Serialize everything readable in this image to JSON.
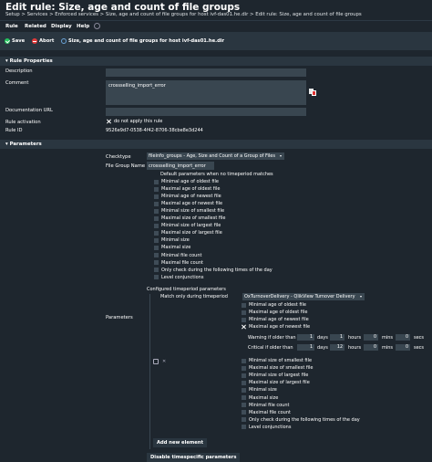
{
  "header": {
    "title": "Edit rule: Size, age and count of file groups",
    "breadcrumb": "Setup > Services > Enforced services > Size, age and count of file groups for host ivf-das01.he.dir > Edit rule: Size, age and count of file groups"
  },
  "menubar": {
    "rule": "Rule",
    "related": "Related",
    "display": "Display",
    "help": "Help"
  },
  "toolbar": {
    "save": "Save",
    "abort": "Abort",
    "service_link": "Size, age and count of file groups for host ivf-das01.he.dir"
  },
  "rule_properties": {
    "heading": "Rule Properties",
    "description_label": "Description",
    "comment_label": "Comment",
    "comment_value": "crossselling_import_error",
    "doc_url_label": "Documentation URL",
    "activation_label": "Rule activation",
    "activation_text": "do not apply this rule",
    "rule_id_label": "Rule ID",
    "rule_id_value": "9526e9d7-0538-4f42-8706-38cbe8e3d244"
  },
  "parameters": {
    "heading": "Parameters",
    "checktype_label": "Checktype",
    "checktype_value": "fileinfo_groups - Age, Size and Count of a Group of Files",
    "file_group_label": "File Group Name",
    "file_group_value": "crossselling_import_error",
    "params_label": "Parameters",
    "default_heading": "Default parameters when no timeperiod matches",
    "default_items": [
      "Minimal age of oldest file",
      "Maximal age of oldest file",
      "Minimal age of newest file",
      "Maximal age of newest file",
      "Minimal size of smallest file",
      "Maximal size of smallest file",
      "Minimal size of largest file",
      "Maximal size of largest file",
      "Minimal size",
      "Maximal size",
      "Minimal file count",
      "Maximal file count",
      "Only check during the following times of the day",
      "Level conjunctions"
    ],
    "configured_heading": "Configured timeperiod parameters",
    "match_label": "Match only during timeperiod",
    "match_value": "OxTurnoverDelivery - QlikView Turnover Delivery",
    "tp_items_top": [
      "Minimal age of oldest file",
      "Maximal age of oldest file",
      "Minimal age of newest file",
      "Maximal age of newest file"
    ],
    "warning_label": "Warning if older than",
    "critical_label": "Critical if older than",
    "warning": {
      "days": "1",
      "hours": "1",
      "mins": "0",
      "secs": "0"
    },
    "critical": {
      "days": "1",
      "hours": "12",
      "mins": "0",
      "secs": "0"
    },
    "unit_days": "days",
    "unit_hours": "hours",
    "unit_mins": "mins",
    "unit_secs": "secs",
    "tp_items_bottom": [
      "Minimal size of smallest file",
      "Maximal size of smallest file",
      "Minimal size of largest file",
      "Maximal size of largest file",
      "Minimal size",
      "Maximal size",
      "Minimal file count",
      "Maximal file count",
      "Only check during the following times of the day",
      "Level conjunctions"
    ],
    "add_element": "Add new element",
    "disable_tp": "Disable timespecific parameters"
  },
  "icons": {
    "save": "check-circle-icon",
    "abort": "minus-circle-icon",
    "service": "info-circle-icon",
    "help_toggle": "circle-minus-icon",
    "clone_comment": "clone-icon"
  },
  "colors": {
    "save_green": "#23c55e",
    "abort_red": "#e33a3a",
    "background": "#1e262e",
    "panel": "#2a3640"
  }
}
